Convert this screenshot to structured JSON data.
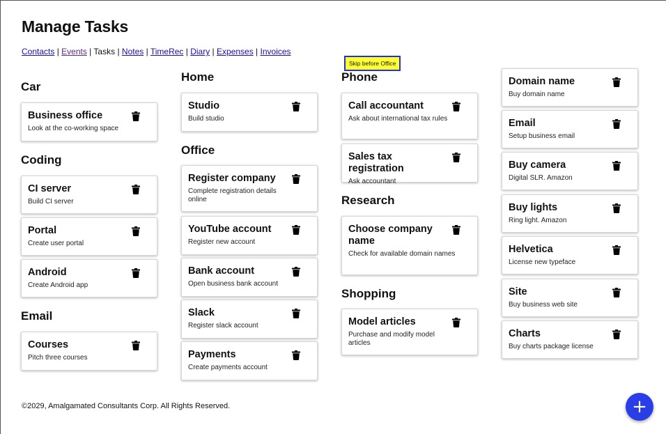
{
  "page": {
    "title": "Manage Tasks",
    "footer": "©2029, Amalgamated Consultants Corp. All Rights Reserved.",
    "fab_label": "+",
    "tooltip": "Skip before Office"
  },
  "nav": {
    "items": [
      {
        "label": "Contacts",
        "link": true
      },
      {
        "label": "Events",
        "link": true,
        "visited": true
      },
      {
        "label": "Tasks",
        "link": false
      },
      {
        "label": "Notes",
        "link": true
      },
      {
        "label": "TimeRec",
        "link": true
      },
      {
        "label": "Diary",
        "link": true
      },
      {
        "label": "Expenses",
        "link": true
      },
      {
        "label": "Invoices",
        "link": true
      }
    ]
  },
  "columns": [
    {
      "categories": [
        {
          "name": "Car",
          "tasks": [
            {
              "title": "Business office",
              "desc": "Look at the co-working space"
            }
          ]
        },
        {
          "name": "Coding",
          "tasks": [
            {
              "title": "CI server",
              "desc": "Build CI server"
            },
            {
              "title": "Portal",
              "desc": "Create user portal"
            },
            {
              "title": "Android",
              "desc": "Create Android app"
            }
          ]
        },
        {
          "name": "Email",
          "tasks": [
            {
              "title": "Courses",
              "desc": "Pitch three courses"
            }
          ]
        }
      ]
    },
    {
      "categories": [
        {
          "name": "Home",
          "tasks": [
            {
              "title": "Studio",
              "desc": "Build studio"
            }
          ]
        },
        {
          "name": "Office",
          "tasks": [
            {
              "title": "Register company",
              "desc": "Complete registration details online"
            },
            {
              "title": "YouTube account",
              "desc": "Register new account"
            },
            {
              "title": "Bank account",
              "desc": "Open business bank account"
            },
            {
              "title": "Slack",
              "desc": "Register slack account"
            },
            {
              "title": "Payments",
              "desc": "Create payments account"
            }
          ]
        }
      ]
    },
    {
      "categories": [
        {
          "name": "Phone",
          "tasks": [
            {
              "title": "Call accountant",
              "desc": "Ask about international tax rules"
            },
            {
              "title": "Sales tax registration",
              "desc": "Ask accountant"
            }
          ]
        },
        {
          "name": "Research",
          "tasks": [
            {
              "title": "Choose company name",
              "desc": "Check for available domain names"
            }
          ]
        },
        {
          "name": "Shopping",
          "tasks": [
            {
              "title": "Model articles",
              "desc": "Purchase and modify model articles"
            }
          ]
        }
      ]
    },
    {
      "categories": [
        {
          "name": "",
          "tasks": [
            {
              "title": "Domain name",
              "desc": "Buy domain name"
            },
            {
              "title": "Email",
              "desc": "Setup business email"
            },
            {
              "title": "Buy camera",
              "desc": "Digital SLR. Amazon"
            },
            {
              "title": "Buy lights",
              "desc": "Ring light. Amazon"
            },
            {
              "title": "Helvetica",
              "desc": "License new typeface"
            },
            {
              "title": "Site",
              "desc": "Buy business web site"
            },
            {
              "title": "Charts",
              "desc": "Buy charts package license"
            }
          ]
        }
      ]
    }
  ],
  "icons": {
    "delete": "trash-icon",
    "add": "plus-icon"
  },
  "colors": {
    "link": "#1a0dab",
    "fab": "#2a3ee8",
    "tooltip_bg": "#ffff33",
    "tooltip_border": "#2233cc"
  }
}
